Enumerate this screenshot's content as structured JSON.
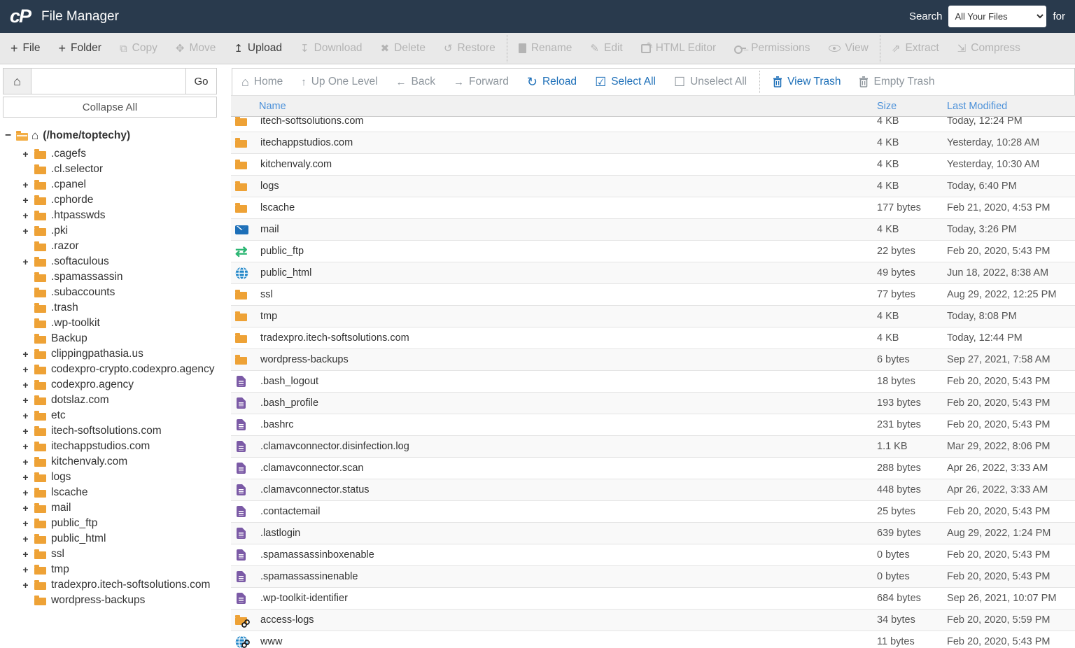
{
  "header": {
    "logo": "cP",
    "title": "File Manager",
    "search_label": "Search",
    "search_scope": "All Your Files",
    "search_suffix": "for"
  },
  "toolbar": {
    "items": [
      {
        "label": "File",
        "icon": "file-plus-icon",
        "enabled": true
      },
      {
        "label": "Folder",
        "icon": "folder-plus-icon",
        "enabled": true
      },
      {
        "label": "Copy",
        "icon": "copy-icon",
        "enabled": false
      },
      {
        "label": "Move",
        "icon": "move-icon",
        "enabled": false
      },
      {
        "label": "Upload",
        "icon": "upload-icon",
        "enabled": true
      },
      {
        "label": "Download",
        "icon": "download-icon",
        "enabled": false
      },
      {
        "label": "Delete",
        "icon": "delete-icon",
        "enabled": false
      },
      {
        "label": "Restore",
        "icon": "restore-icon",
        "enabled": false,
        "divider_after": true
      },
      {
        "label": "Rename",
        "icon": "rename-icon",
        "enabled": false
      },
      {
        "label": "Edit",
        "icon": "edit-icon",
        "enabled": false
      },
      {
        "label": "HTML Editor",
        "icon": "html-editor-icon",
        "enabled": false
      },
      {
        "label": "Permissions",
        "icon": "key-icon",
        "enabled": false
      },
      {
        "label": "View",
        "icon": "eye-icon",
        "enabled": false,
        "divider_after": true
      },
      {
        "label": "Extract",
        "icon": "extract-icon",
        "enabled": false
      },
      {
        "label": "Compress",
        "icon": "compress-icon",
        "enabled": false
      }
    ]
  },
  "navbar": {
    "path_input_value": "",
    "go_label": "Go",
    "items": [
      {
        "label": "Home",
        "icon": "home-icon",
        "style": "muted"
      },
      {
        "label": "Up One Level",
        "icon": "up-arrow-icon",
        "style": "muted"
      },
      {
        "label": "Back",
        "icon": "back-arrow-icon",
        "style": "muted"
      },
      {
        "label": "Forward",
        "icon": "forward-arrow-icon",
        "style": "muted"
      },
      {
        "label": "Reload",
        "icon": "reload-icon",
        "style": "link"
      },
      {
        "label": "Select All",
        "icon": "checkbox-checked-icon",
        "style": "link"
      },
      {
        "label": "Unselect All",
        "icon": "checkbox-empty-icon",
        "style": "muted",
        "divider_after": true
      },
      {
        "label": "View Trash",
        "icon": "trash-icon",
        "style": "link"
      },
      {
        "label": "Empty Trash",
        "icon": "trash-icon",
        "style": "muted"
      }
    ]
  },
  "sidebar": {
    "collapse_all_label": "Collapse All",
    "root_label": "(/home/toptechy)",
    "items": [
      {
        "label": ".cagefs",
        "expandable": true
      },
      {
        "label": ".cl.selector",
        "expandable": false
      },
      {
        "label": ".cpanel",
        "expandable": true
      },
      {
        "label": ".cphorde",
        "expandable": true
      },
      {
        "label": ".htpasswds",
        "expandable": true
      },
      {
        "label": ".pki",
        "expandable": true
      },
      {
        "label": ".razor",
        "expandable": false
      },
      {
        "label": ".softaculous",
        "expandable": true
      },
      {
        "label": ".spamassassin",
        "expandable": false
      },
      {
        "label": ".subaccounts",
        "expandable": false
      },
      {
        "label": ".trash",
        "expandable": false
      },
      {
        "label": ".wp-toolkit",
        "expandable": false
      },
      {
        "label": "Backup",
        "expandable": false
      },
      {
        "label": "clippingpathasia.us",
        "expandable": true
      },
      {
        "label": "codexpro-crypto.codexpro.agency",
        "expandable": true
      },
      {
        "label": "codexpro.agency",
        "expandable": true
      },
      {
        "label": "dotslaz.com",
        "expandable": true
      },
      {
        "label": "etc",
        "expandable": true
      },
      {
        "label": "itech-softsolutions.com",
        "expandable": true
      },
      {
        "label": "itechappstudios.com",
        "expandable": true
      },
      {
        "label": "kitchenvaly.com",
        "expandable": true
      },
      {
        "label": "logs",
        "expandable": true
      },
      {
        "label": "lscache",
        "expandable": true
      },
      {
        "label": "mail",
        "expandable": true
      },
      {
        "label": "public_ftp",
        "expandable": true
      },
      {
        "label": "public_html",
        "expandable": true
      },
      {
        "label": "ssl",
        "expandable": true
      },
      {
        "label": "tmp",
        "expandable": true
      },
      {
        "label": "tradexpro.itech-softsolutions.com",
        "expandable": true
      },
      {
        "label": "wordpress-backups",
        "expandable": false
      }
    ]
  },
  "filelist": {
    "columns": [
      "Name",
      "Size",
      "Last Modified"
    ],
    "rows": [
      {
        "name": "itech-softsolutions.com",
        "icon": "folder-icon",
        "size": "4 KB",
        "modified": "Today, 12:24 PM"
      },
      {
        "name": "itechappstudios.com",
        "icon": "folder-icon",
        "size": "4 KB",
        "modified": "Yesterday, 10:28 AM"
      },
      {
        "name": "kitchenvaly.com",
        "icon": "folder-icon",
        "size": "4 KB",
        "modified": "Yesterday, 10:30 AM"
      },
      {
        "name": "logs",
        "icon": "folder-icon",
        "size": "4 KB",
        "modified": "Today, 6:40 PM"
      },
      {
        "name": "lscache",
        "icon": "folder-icon",
        "size": "177 bytes",
        "modified": "Feb 21, 2020, 4:53 PM"
      },
      {
        "name": "mail",
        "icon": "mail-icon",
        "size": "4 KB",
        "modified": "Today, 3:26 PM"
      },
      {
        "name": "public_ftp",
        "icon": "ftp-icon",
        "size": "22 bytes",
        "modified": "Feb 20, 2020, 5:43 PM"
      },
      {
        "name": "public_html",
        "icon": "globe-icon",
        "size": "49 bytes",
        "modified": "Jun 18, 2022, 8:38 AM"
      },
      {
        "name": "ssl",
        "icon": "folder-icon",
        "size": "77 bytes",
        "modified": "Aug 29, 2022, 12:25 PM"
      },
      {
        "name": "tmp",
        "icon": "folder-icon",
        "size": "4 KB",
        "modified": "Today, 8:08 PM"
      },
      {
        "name": "tradexpro.itech-softsolutions.com",
        "icon": "folder-icon",
        "size": "4 KB",
        "modified": "Today, 12:44 PM"
      },
      {
        "name": "wordpress-backups",
        "icon": "folder-icon",
        "size": "6 bytes",
        "modified": "Sep 27, 2021, 7:58 AM"
      },
      {
        "name": ".bash_logout",
        "icon": "doc-icon",
        "size": "18 bytes",
        "modified": "Feb 20, 2020, 5:43 PM"
      },
      {
        "name": ".bash_profile",
        "icon": "doc-icon",
        "size": "193 bytes",
        "modified": "Feb 20, 2020, 5:43 PM"
      },
      {
        "name": ".bashrc",
        "icon": "doc-icon",
        "size": "231 bytes",
        "modified": "Feb 20, 2020, 5:43 PM"
      },
      {
        "name": ".clamavconnector.disinfection.log",
        "icon": "doc-icon",
        "size": "1.1 KB",
        "modified": "Mar 29, 2022, 8:06 PM"
      },
      {
        "name": ".clamavconnector.scan",
        "icon": "doc-icon",
        "size": "288 bytes",
        "modified": "Apr 26, 2022, 3:33 AM"
      },
      {
        "name": ".clamavconnector.status",
        "icon": "doc-icon",
        "size": "448 bytes",
        "modified": "Apr 26, 2022, 3:33 AM"
      },
      {
        "name": ".contactemail",
        "icon": "doc-icon",
        "size": "25 bytes",
        "modified": "Feb 20, 2020, 5:43 PM"
      },
      {
        "name": ".lastlogin",
        "icon": "doc-icon",
        "size": "639 bytes",
        "modified": "Aug 29, 2022, 1:24 PM"
      },
      {
        "name": ".spamassassinboxenable",
        "icon": "doc-icon",
        "size": "0 bytes",
        "modified": "Feb 20, 2020, 5:43 PM"
      },
      {
        "name": ".spamassassinenable",
        "icon": "doc-icon",
        "size": "0 bytes",
        "modified": "Feb 20, 2020, 5:43 PM"
      },
      {
        "name": ".wp-toolkit-identifier",
        "icon": "doc-icon",
        "size": "684 bytes",
        "modified": "Sep 26, 2021, 10:07 PM"
      },
      {
        "name": "access-logs",
        "icon": "folder-link-icon",
        "size": "34 bytes",
        "modified": "Feb 20, 2020, 5:59 PM"
      },
      {
        "name": "www",
        "icon": "globe-link-icon",
        "size": "11 bytes",
        "modified": "Feb 20, 2020, 5:43 PM"
      }
    ]
  },
  "colors": {
    "topbar": "#293a4d",
    "accent_blue": "#1d6fb8",
    "header_link_blue": "#4a90d9",
    "folder_orange": "#eea236",
    "doc_purple": "#7b5aa6",
    "ftp_green": "#2bb673"
  }
}
